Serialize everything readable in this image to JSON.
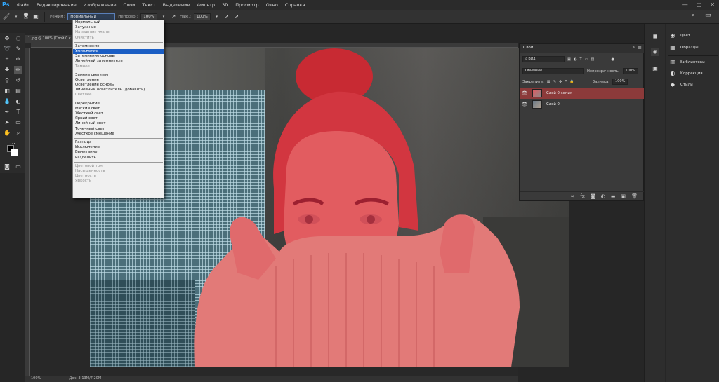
{
  "app": {
    "logo": "Ps"
  },
  "menu": [
    "Файл",
    "Редактирование",
    "Изображение",
    "Слои",
    "Текст",
    "Выделение",
    "Фильтр",
    "3D",
    "Просмотр",
    "Окно",
    "Справка"
  ],
  "options": {
    "brush_size": "50",
    "mode_label": "Режим:",
    "mode_value": "Нормальный",
    "opacity_label": "Непрозр.:",
    "opacity_value": "100%",
    "flow_label": "Наж.:",
    "flow_value": "100%"
  },
  "document": {
    "tab_title": "1.jpg @ 100% (Слой 0 к",
    "status_zoom": "100%",
    "status_doc": "Док: 3,13М/7,20М"
  },
  "blend_modes": [
    [
      {
        "label": "Нормальный",
        "disabled": false
      },
      {
        "label": "Затухание",
        "disabled": false
      },
      {
        "label": "На заднем плане",
        "disabled": true
      },
      {
        "label": "Очистить",
        "disabled": true
      }
    ],
    [
      {
        "label": "Затемнение",
        "disabled": false
      },
      {
        "label": "Умножение",
        "disabled": false,
        "selected": true
      },
      {
        "label": "Затемнение основы",
        "disabled": false
      },
      {
        "label": "Линейный затемнитель",
        "disabled": false
      },
      {
        "label": "Темнее",
        "disabled": true
      }
    ],
    [
      {
        "label": "Замена светлым",
        "disabled": false
      },
      {
        "label": "Осветление",
        "disabled": false
      },
      {
        "label": "Осветление основы",
        "disabled": false
      },
      {
        "label": "Линейный осветлитель (добавить)",
        "disabled": false
      },
      {
        "label": "Светлее",
        "disabled": true
      }
    ],
    [
      {
        "label": "Перекрытие",
        "disabled": false
      },
      {
        "label": "Мягкий свет",
        "disabled": false
      },
      {
        "label": "Жесткий свет",
        "disabled": false
      },
      {
        "label": "Яркий свет",
        "disabled": false
      },
      {
        "label": "Линейный свет",
        "disabled": false
      },
      {
        "label": "Точечный свет",
        "disabled": false
      },
      {
        "label": "Жесткое смешение",
        "disabled": false
      }
    ],
    [
      {
        "label": "Разница",
        "disabled": false
      },
      {
        "label": "Исключение",
        "disabled": false
      },
      {
        "label": "Вычитание",
        "disabled": false
      },
      {
        "label": "Разделить",
        "disabled": false
      }
    ],
    [
      {
        "label": "Цветовой тон",
        "disabled": true
      },
      {
        "label": "Насыщенность",
        "disabled": true
      },
      {
        "label": "Цветность",
        "disabled": true
      },
      {
        "label": "Яркость",
        "disabled": true
      }
    ]
  ],
  "layers_panel": {
    "tab_label": "Слои",
    "filter_label": "Вид",
    "blend_value": "Обычные",
    "opacity_label": "Непрозрачность:",
    "opacity_value": "100%",
    "lock_label": "Закрепить:",
    "fill_label": "Заливка:",
    "fill_value": "100%",
    "layers": [
      {
        "name": "Слой 0 копия",
        "active": true
      },
      {
        "name": "Слой 0",
        "active": false
      }
    ]
  },
  "dock": {
    "items": [
      {
        "label": "Цвет",
        "icon": "color-wheel-icon"
      },
      {
        "label": "Образцы",
        "icon": "swatches-icon"
      },
      {
        "label": "Библиотеки",
        "icon": "libraries-icon"
      },
      {
        "label": "Коррекция",
        "icon": "adjustments-icon"
      },
      {
        "label": "Стили",
        "icon": "styles-icon"
      }
    ]
  }
}
